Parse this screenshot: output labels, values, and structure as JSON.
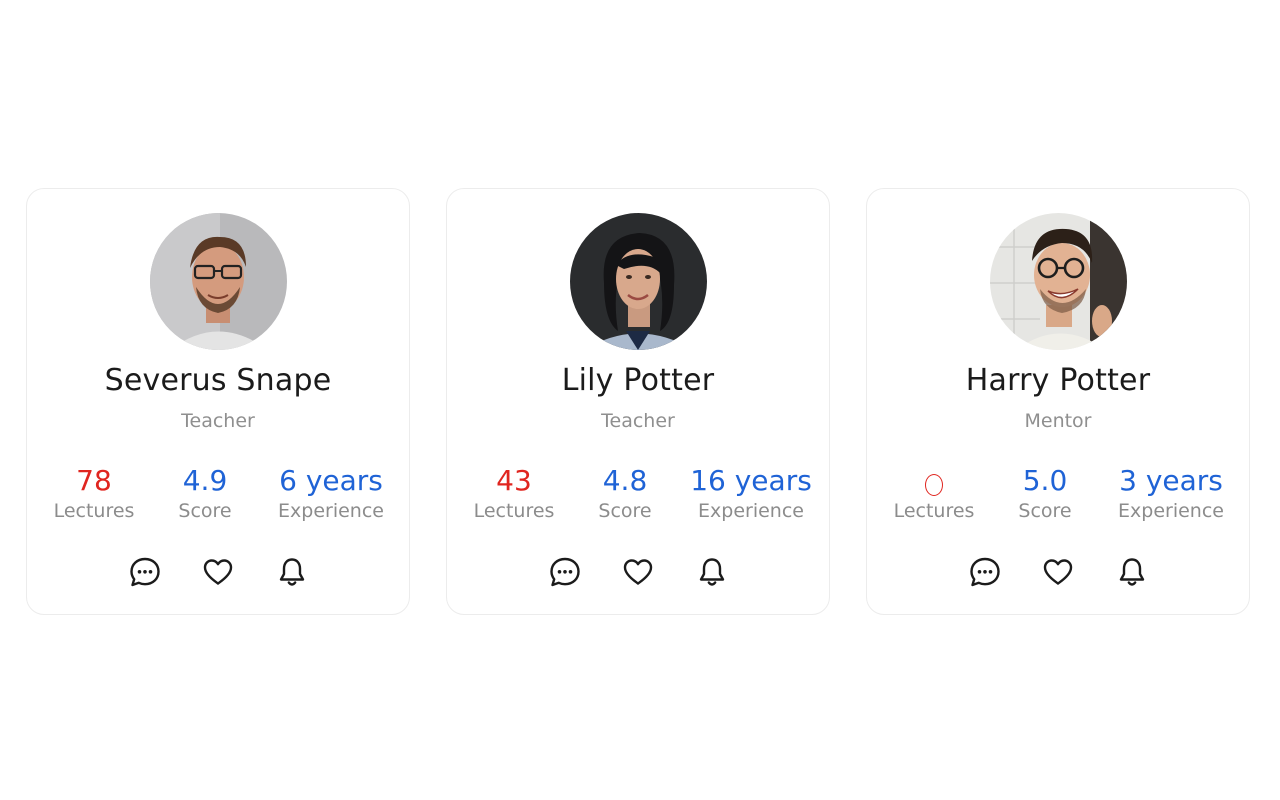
{
  "cards": [
    {
      "name": "Severus Snape",
      "role": "Teacher",
      "lectures": "78",
      "score": "4.9",
      "experience": "6 years",
      "lectures_label": "Lectures",
      "score_label": "Score",
      "experience_label": "Experience",
      "icons": [
        "chat-icon",
        "heart-icon",
        "bell-icon"
      ],
      "lectures_state": "loaded"
    },
    {
      "name": "Lily Potter",
      "role": "Teacher",
      "lectures": "43",
      "score": "4.8",
      "experience": "16 years",
      "lectures_label": "Lectures",
      "score_label": "Score",
      "experience_label": "Experience",
      "icons": [
        "chat-icon",
        "heart-icon",
        "bell-icon"
      ],
      "lectures_state": "loaded"
    },
    {
      "name": "Harry Potter",
      "role": "Mentor",
      "lectures": "",
      "score": "5.0",
      "experience": "3 years",
      "lectures_label": "Lectures",
      "score_label": "Score",
      "experience_label": "Experience",
      "icons": [
        "chat-icon",
        "heart-icon",
        "bell-icon"
      ],
      "lectures_state": "loading"
    }
  ],
  "colors": {
    "lectures": "#e0251f",
    "accent": "#1f63d6",
    "label": "#8c8c8c",
    "border": "#ececec"
  }
}
